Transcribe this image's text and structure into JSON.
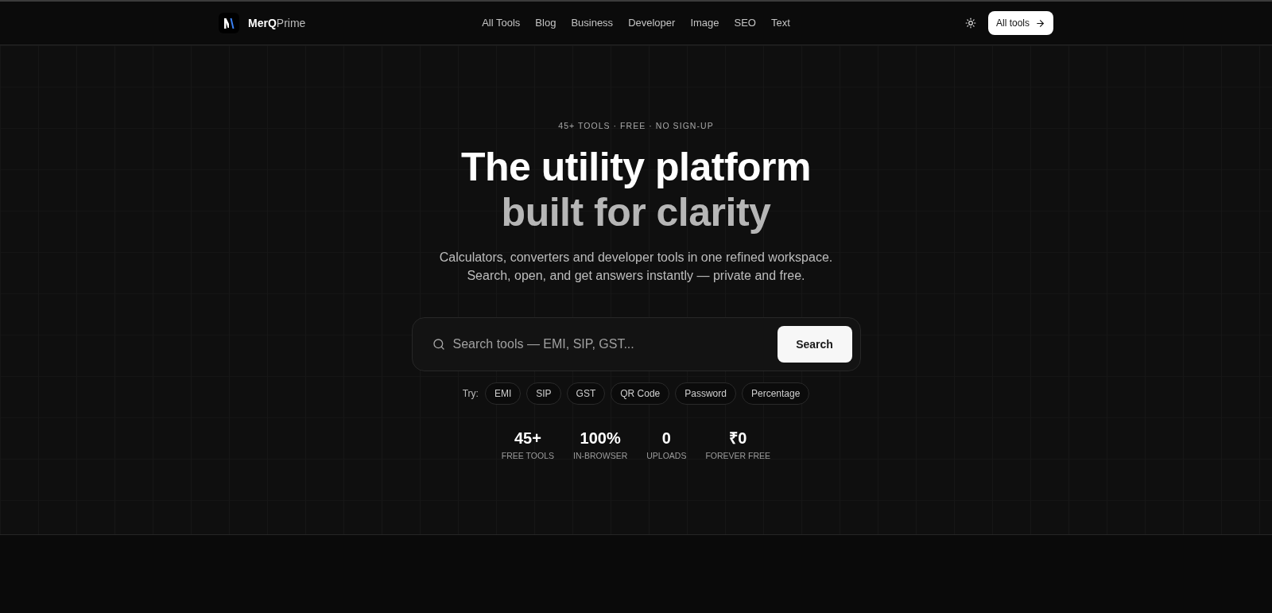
{
  "header": {
    "brand": "**MerQ**Prime",
    "nav": [
      {
        "label": "All Tools"
      },
      {
        "label": "Blog"
      },
      {
        "label": "Business"
      },
      {
        "label": "Developer"
      },
      {
        "label": "Image"
      },
      {
        "label": "SEO"
      },
      {
        "label": "Text"
      }
    ],
    "cta": {
      "label": "All tools"
    }
  },
  "hero": {
    "eyebrow": "45+ TOOLS · FREE · NO SIGN-UP",
    "title_lines": [
      "The utility platform",
      "built for clarity"
    ],
    "subtitle_lines": [
      "Calculators, converters and developer tools in one refined workspace.",
      "Search, open, and get answers instantly — private and free."
    ],
    "search": {
      "placeholder": "Search tools — EMI, SIP, GST...",
      "button": "Search"
    },
    "try_label": "Try:",
    "suggestions": [
      "EMI",
      "SIP",
      "GST",
      "QR Code",
      "Password",
      "Percentage"
    ],
    "stats": [
      {
        "value": "45+",
        "label": "FREE TOOLS"
      },
      {
        "value": "100%",
        "label": "IN-BROWSER"
      },
      {
        "value": "0",
        "label": "UPLOADS"
      },
      {
        "value": "₹0",
        "label": "FOREVER FREE"
      }
    ]
  }
}
